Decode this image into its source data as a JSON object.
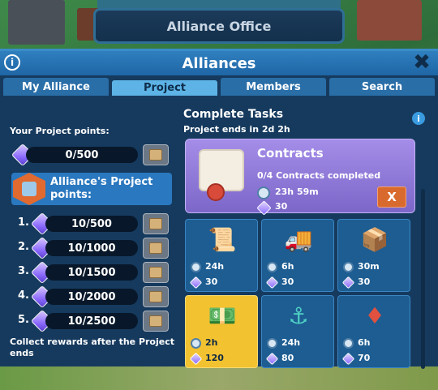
{
  "office_banner": "Alliance Office",
  "window": {
    "title": "Alliances",
    "info": "i",
    "close": "✖"
  },
  "tabs": [
    {
      "label": "My Alliance"
    },
    {
      "label": "Project"
    },
    {
      "label": "Members"
    },
    {
      "label": "Search"
    }
  ],
  "left": {
    "your_points_label": "Your Project points:",
    "your_points_value": "0/500",
    "alliance_points_label": "Alliance's Project points:",
    "tiers": [
      {
        "rank": "1.",
        "value": "10/500"
      },
      {
        "rank": "2.",
        "value": "10/1000"
      },
      {
        "rank": "3.",
        "value": "10/1500"
      },
      {
        "rank": "4.",
        "value": "10/2000"
      },
      {
        "rank": "5.",
        "value": "10/2500"
      }
    ],
    "collect_note": "Collect rewards after the Project ends"
  },
  "right": {
    "title": "Complete Tasks",
    "ends": "Project ends in 2d 2h",
    "info": "i",
    "featured": {
      "name": "Contracts",
      "desc": "0/4 Contracts completed",
      "time": "23h 59m",
      "gems": "30",
      "cancel": "X"
    },
    "tasks": [
      {
        "icon": "contract-scroll-icon",
        "time": "24h",
        "gems": "30"
      },
      {
        "icon": "truck-unload-icon",
        "time": "6h",
        "gems": "30"
      },
      {
        "icon": "crates-icon",
        "time": "30m",
        "gems": "30"
      },
      {
        "icon": "cash-stack-icon",
        "time": "2h",
        "gems": "120"
      },
      {
        "icon": "anchor-icon",
        "time": "24h",
        "gems": "80"
      },
      {
        "icon": "ruby-ore-icon",
        "time": "6h",
        "gems": "70"
      }
    ]
  },
  "colors": {
    "panel": "#163a5e",
    "title_bar": "#2f7fbf",
    "tab_active": "#5db3e6",
    "featured": "#a48de8",
    "task_tile": "#1d5d92",
    "task_highlight": "#f2c230",
    "cancel_button": "#d96a2e"
  }
}
